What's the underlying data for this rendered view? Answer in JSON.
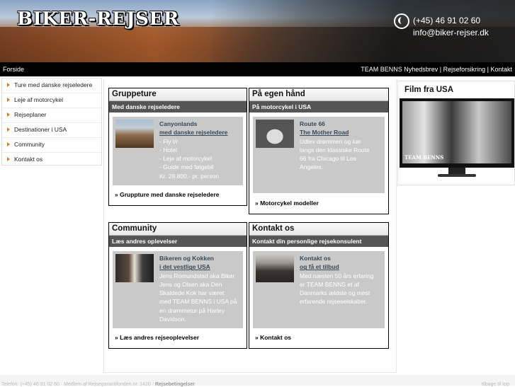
{
  "header": {
    "logo": "BIKER-REJSER",
    "phone": "(+45) 46 91 02 60",
    "email": "info@biker-rejser.dk"
  },
  "nav": {
    "home": "Forside",
    "links": [
      "TEAM BENNS Nyhedsbrev",
      "Rejseforsikring",
      "Kontakt"
    ],
    "separator": " | "
  },
  "sidebar": {
    "items": [
      {
        "label": "Ture med danske rejseledere"
      },
      {
        "label": "Leje af motorcykel"
      },
      {
        "label": "Rejseplaner"
      },
      {
        "label": "Destinationer i USA"
      },
      {
        "label": "Community"
      },
      {
        "label": "Kontakt os"
      }
    ]
  },
  "boxes": {
    "gruppeture": {
      "title": "Gruppeture",
      "sub": "Med danske rejseledere",
      "heading": "Canyonlands",
      "heading2": "med danske rejseledere",
      "lines": [
        "- Fly t/r",
        "- Hotel",
        "- Leje af motorcykel",
        "- Guide med følgebil",
        "Kr. 28.800,- pr. person"
      ],
      "footer": "» Gruppture med danske rejseledere"
    },
    "egenhaand": {
      "title": "På egen hånd",
      "sub": "På motorcykel i USA",
      "heading": "Route 66",
      "heading2": "The Mother Road",
      "lines": [
        "Udlev drømmen og kør",
        "langs den klassiske Route",
        "66 fra Chicago til Los",
        "Angeles."
      ],
      "footer": "» Motorcykel modeller"
    },
    "community": {
      "title": "Community",
      "sub": "Læs andres oplevelser",
      "heading": "Bikeren og Kokken",
      "heading2": "i det vestlige USA",
      "lines": [
        "Jens Romundstad aka Biker",
        "Jens og Olsen aka Den",
        "Skaldede Kok har været",
        "med TEAM BENNS i USA på",
        "en drømmetur på Harley",
        "Davidson."
      ],
      "footer": "» Læs andres rejseoplevelser"
    },
    "kontakt": {
      "title": "Kontakt os",
      "sub": "Kontakt din personlige rejsekonsulent",
      "heading": "Kontakt os",
      "heading2": "og få et tilbud",
      "lines": [
        "Med næsten 50 års erfaring",
        "er TEAM BENNS et af",
        "Danmarks ældste og mest",
        "erfarende rejseselskaber."
      ],
      "footer": "» Kontakt os"
    }
  },
  "film": {
    "title": "Film fra USA",
    "brand": "TEAM BENNS"
  },
  "footer": {
    "left_prefix": "Telefon: (+45) 46 91 02 60 · Medlem af Rejsegarantifonden nr. 1420 ·",
    "left_bold": "Rejsebetingelser",
    "right": "tilbage til top"
  }
}
